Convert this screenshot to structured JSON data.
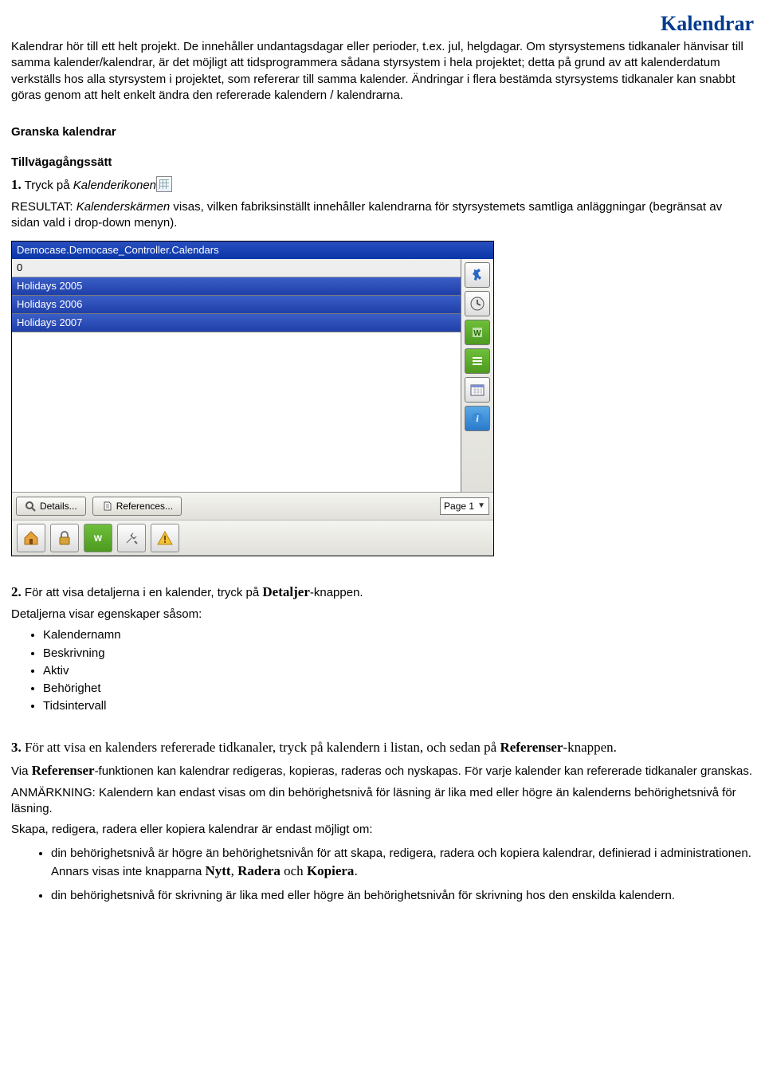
{
  "title": "Kalendrar",
  "intro": {
    "p1": "Kalendrar hör till ett helt projekt. De innehåller undantagsdagar eller perioder, t.ex. jul, helgdagar. Om styrsystemens tidkanaler hänvisar till samma kalender/kalendrar, är det möjligt att tidsprogrammera sådana styrsystem i hela projektet; detta på grund av att kalenderdatum verkställs hos alla styrsystem i projektet, som refererar till samma kalender. Ändringar i flera bestämda styrsystems tidkanaler kan snabbt göras genom att helt enkelt ändra den refererade kalendern / kalendrarna."
  },
  "section1": {
    "heading": "Granska kalendrar",
    "sub": "Tillvägagångssätt",
    "step1_prefix": "1.",
    "step1_text": " Tryck på ",
    "step1_italic": "Kalenderikonen",
    "result_label": "RESULTAT: ",
    "result_italic": "Kalenderskärmen",
    "result_rest": " visas, vilken fabriksinställt innehåller kalendrarna för styrsystemets samtliga anläggningar (begränsat av sidan vald i drop-down menyn)."
  },
  "shot": {
    "titlebar": "Democase.Democase_Controller.Calendars",
    "row0": "0",
    "rows": [
      "Holidays 2005",
      "Holidays 2006",
      "Holidays 2007"
    ],
    "btn_details": "Details...",
    "btn_refs": "References...",
    "page": "Page 1"
  },
  "section2": {
    "step2_prefix": "2.",
    "step2_text": " För att visa detaljerna i en kalender, tryck på ",
    "step2_btn": "Detaljer",
    "step2_suffix": "-knappen.",
    "line2": "Detaljerna visar egenskaper såsom:",
    "items": [
      "Kalendernamn",
      "Beskrivning",
      "Aktiv",
      "Behörighet",
      "Tidsintervall"
    ]
  },
  "section3": {
    "step3_prefix": "3.",
    "step3_line": " För att visa en kalenders refererade tidkanaler, tryck på kalendern i listan, och sedan på ",
    "step3_btn": "Referenser",
    "step3_suffix": "-knappen.",
    "via1": "Via ",
    "via_btn": "Referenser",
    "via2": "-funktionen kan kalendrar redigeras, kopieras, raderas och nyskapas. För varje kalender kan refererade tidkanaler granskas.",
    "anm": "ANMÄRKNING: Kalendern kan endast visas om din behörighetsnivå för läsning är lika med eller högre än kalenderns behörighetsnivå för läsning.",
    "skapa": "Skapa, redigera, radera eller kopiera kalendrar är endast möjligt om:",
    "b1a": "din behörighetsnivå är högre än behörighetsnivån för att skapa, redigera, radera och kopiera kalendrar, definierad i administrationen. Annars visas inte knapparna ",
    "b1_nytt": "Nytt",
    "b1_sep1": ", ",
    "b1_radera": "Radera",
    "b1_sep2": " och ",
    "b1_kopiera": "Kopiera",
    "b1_end": ".",
    "b2": "din behörighetsnivå för skrivning är lika med eller högre än behörighetsnivån för skrivning hos den enskilda kalendern."
  }
}
